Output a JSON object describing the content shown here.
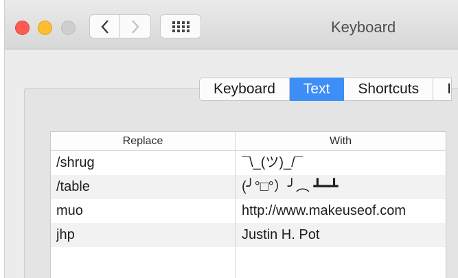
{
  "window": {
    "title": "Keyboard"
  },
  "tabs": [
    {
      "label": "Keyboard",
      "active": false
    },
    {
      "label": "Text",
      "active": true
    },
    {
      "label": "Shortcuts",
      "active": false
    },
    {
      "label": "I",
      "active": false
    }
  ],
  "table": {
    "headers": [
      "Replace",
      "With"
    ],
    "rows": [
      {
        "replace": "/shrug",
        "with": "¯\\_(ツ)_/¯"
      },
      {
        "replace": "/table",
        "with": "(╯°□°）╯︵ ┻━┻"
      },
      {
        "replace": "muo",
        "with": "http://www.makeuseof.com"
      },
      {
        "replace": "jhp",
        "with": "Justin H. Pot"
      },
      {
        "replace": "",
        "with": ""
      }
    ]
  },
  "colors": {
    "accent": "#3d8ef7",
    "close": "#fd5b54",
    "minimize": "#fdbd2f"
  }
}
